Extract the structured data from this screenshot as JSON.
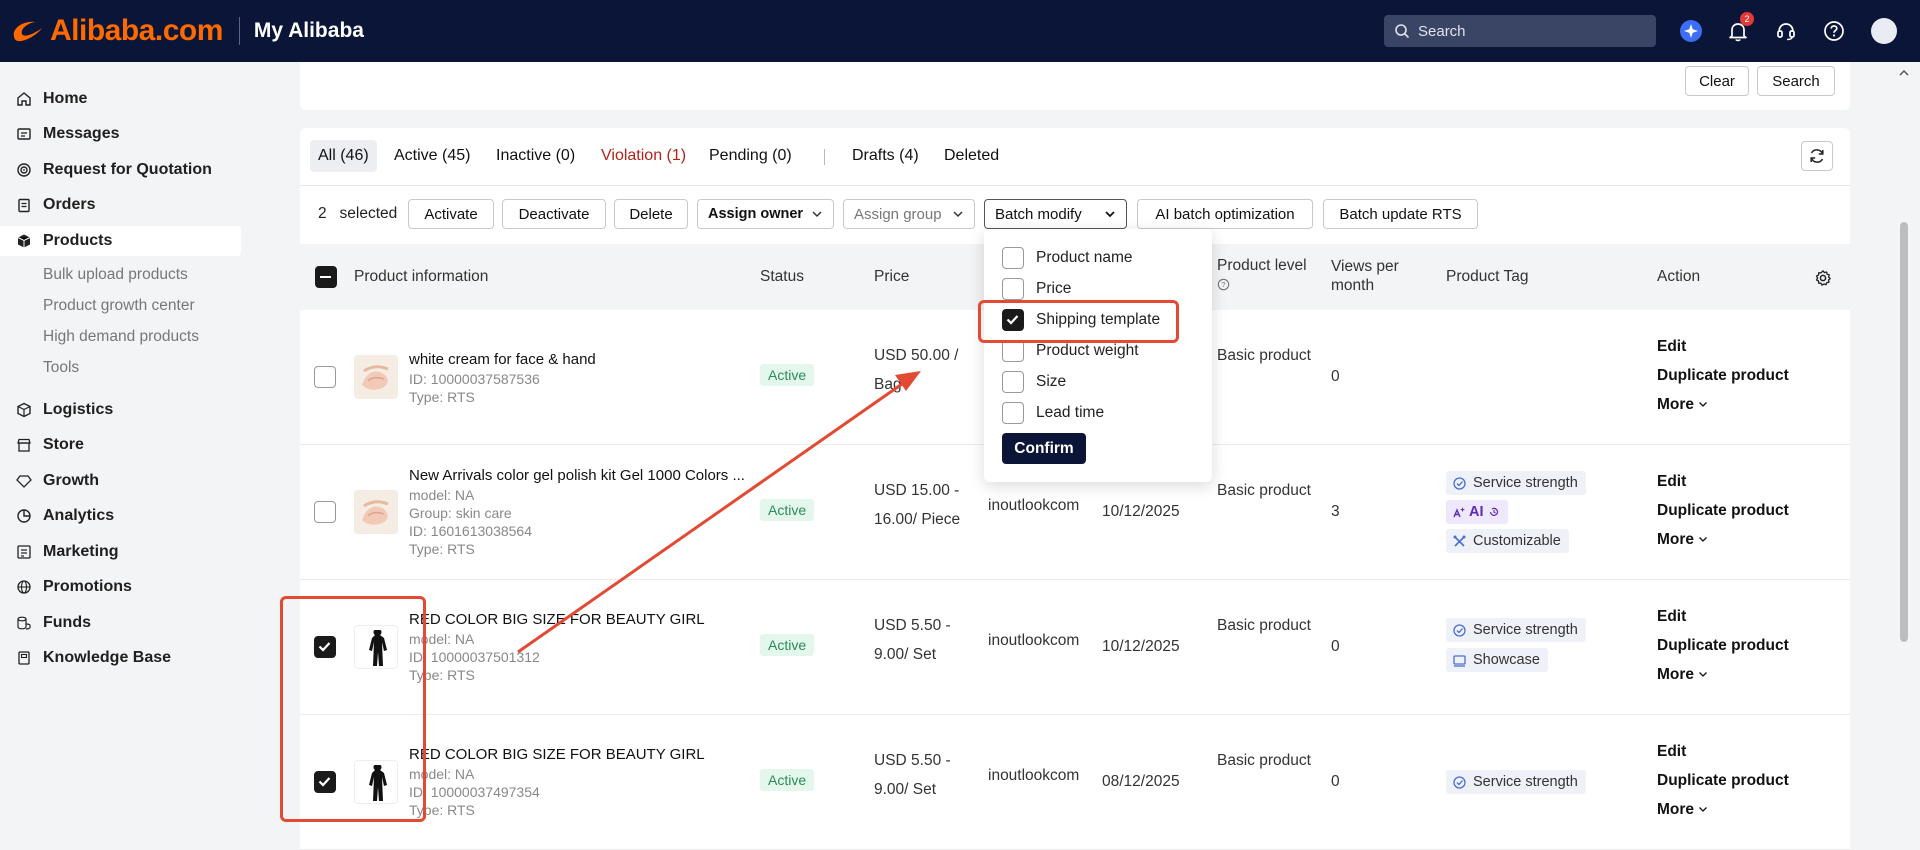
{
  "header": {
    "brand": "Alibaba.com",
    "section": "My Alibaba",
    "search_placeholder": "Search",
    "notification_count": "2"
  },
  "sidebar": {
    "items": [
      {
        "label": "Home",
        "icon": "home-icon"
      },
      {
        "label": "Messages",
        "icon": "messages-icon"
      },
      {
        "label": "Request for Quotation",
        "icon": "target-icon"
      },
      {
        "label": "Orders",
        "icon": "clipboard-icon"
      },
      {
        "label": "Products",
        "icon": "box-icon",
        "active": true
      },
      {
        "label": "Logistics",
        "icon": "truck-icon"
      },
      {
        "label": "Store",
        "icon": "store-icon"
      },
      {
        "label": "Growth",
        "icon": "diamond-icon"
      },
      {
        "label": "Analytics",
        "icon": "pie-icon"
      },
      {
        "label": "Marketing",
        "icon": "marketing-icon"
      },
      {
        "label": "Promotions",
        "icon": "globe-icon"
      },
      {
        "label": "Funds",
        "icon": "coins-icon"
      },
      {
        "label": "Knowledge Base",
        "icon": "book-icon"
      }
    ],
    "sub_items": [
      "Bulk upload products",
      "Product growth center",
      "High demand products",
      "Tools"
    ]
  },
  "filter": {
    "clear_label": "Clear",
    "search_label": "Search"
  },
  "tabs": [
    "All (46)",
    "Active (45)",
    "Inactive (0)",
    "Violation (1)",
    "Pending (0)",
    "Drafts (4)",
    "Deleted"
  ],
  "toolbar": {
    "selected_count": "2",
    "selected_label": "selected",
    "activate": "Activate",
    "deactivate": "Deactivate",
    "delete": "Delete",
    "assign_owner": "Assign owner",
    "assign_group": "Assign group",
    "batch_modify": "Batch modify",
    "ai_batch": "AI batch optimization",
    "batch_rts": "Batch update RTS"
  },
  "batch_menu": {
    "options": [
      {
        "label": "Product name",
        "checked": false
      },
      {
        "label": "Price",
        "checked": false
      },
      {
        "label": "Shipping template",
        "checked": true
      },
      {
        "label": "Product weight",
        "checked": false
      },
      {
        "label": "Size",
        "checked": false
      },
      {
        "label": "Lead time",
        "checked": false
      }
    ],
    "confirm": "Confirm"
  },
  "table": {
    "headers": {
      "product": "Product information",
      "status": "Status",
      "price": "Price",
      "level": "Product level",
      "views1": "Views per",
      "views2": "month",
      "tag": "Product Tag",
      "action": "Action"
    },
    "rows": [
      {
        "title": "white cream for face & hand",
        "meta": [
          "ID: 10000037587536",
          "Type: RTS"
        ],
        "status": "Active",
        "price": [
          "USD 50.00 /",
          "Bag"
        ],
        "owner": "",
        "date": "",
        "level": "Basic product",
        "views": "0",
        "tags": [],
        "actions": [
          "Edit",
          "Duplicate product",
          "More"
        ]
      },
      {
        "title": "New Arrivals color gel polish kit Gel 1000 Colors ...",
        "meta": [
          "model: NA",
          "Group: skin care",
          "ID: 1601613038564",
          "Type: RTS"
        ],
        "status": "Active",
        "price": [
          "USD 15.00 -",
          "16.00/ Piece"
        ],
        "owner": "inoutlookcom",
        "date": "10/12/2025",
        "level": "Basic product",
        "views": "3",
        "tags": [
          "Service strength",
          "AI",
          "Customizable"
        ],
        "actions": [
          "Edit",
          "Duplicate product",
          "More"
        ]
      },
      {
        "title": "RED COLOR BIG SIZE FOR BEAUTY GIRL",
        "meta": [
          "model: NA",
          "ID: 10000037501312",
          "Type: RTS"
        ],
        "status": "Active",
        "price": [
          "USD 5.50 -",
          "9.00/ Set"
        ],
        "owner": "inoutlookcom",
        "date": "10/12/2025",
        "level": "Basic product",
        "views": "0",
        "tags": [
          "Service strength",
          "Showcase"
        ],
        "actions": [
          "Edit",
          "Duplicate product",
          "More"
        ]
      },
      {
        "title": "RED COLOR BIG SIZE FOR BEAUTY GIRL",
        "meta": [
          "model: NA",
          "ID: 10000037497354",
          "Type: RTS"
        ],
        "status": "Active",
        "price": [
          "USD 5.50 -",
          "9.00/ Set"
        ],
        "owner": "inoutlookcom",
        "date": "08/12/2025",
        "level": "Basic product",
        "views": "0",
        "tags": [
          "Service strength"
        ],
        "actions": [
          "Edit",
          "Duplicate product",
          "More"
        ]
      }
    ]
  },
  "colors": {
    "header_bg": "#0b1538",
    "brand_orange": "#ff6a00",
    "annotation_red": "#e24a33",
    "active_green": "#2b8a57"
  }
}
